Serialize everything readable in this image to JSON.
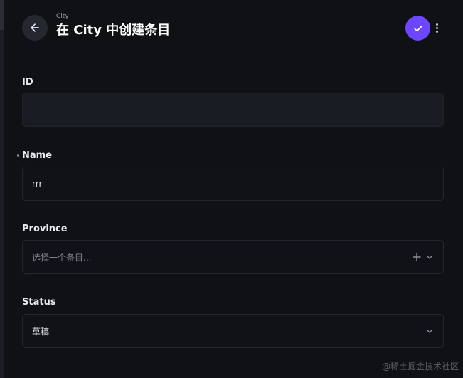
{
  "header": {
    "breadcrumb": "City",
    "title": "在 City 中创建条目"
  },
  "icons": {
    "back": "arrow-left-icon",
    "save": "check-icon",
    "more": "more-vertical-icon",
    "add": "plus-icon",
    "dropdown": "chevron-down-icon"
  },
  "colors": {
    "background": "#0f1115",
    "accent": "#6c47ff"
  },
  "fields": {
    "id": {
      "label": "ID",
      "value": ""
    },
    "name": {
      "label": "Name",
      "value": "rrr",
      "required": true
    },
    "province": {
      "label": "Province",
      "placeholder": "选择一个条目..."
    },
    "status": {
      "label": "Status",
      "value": "草稿"
    }
  },
  "watermark": "@稀土掘金技术社区"
}
